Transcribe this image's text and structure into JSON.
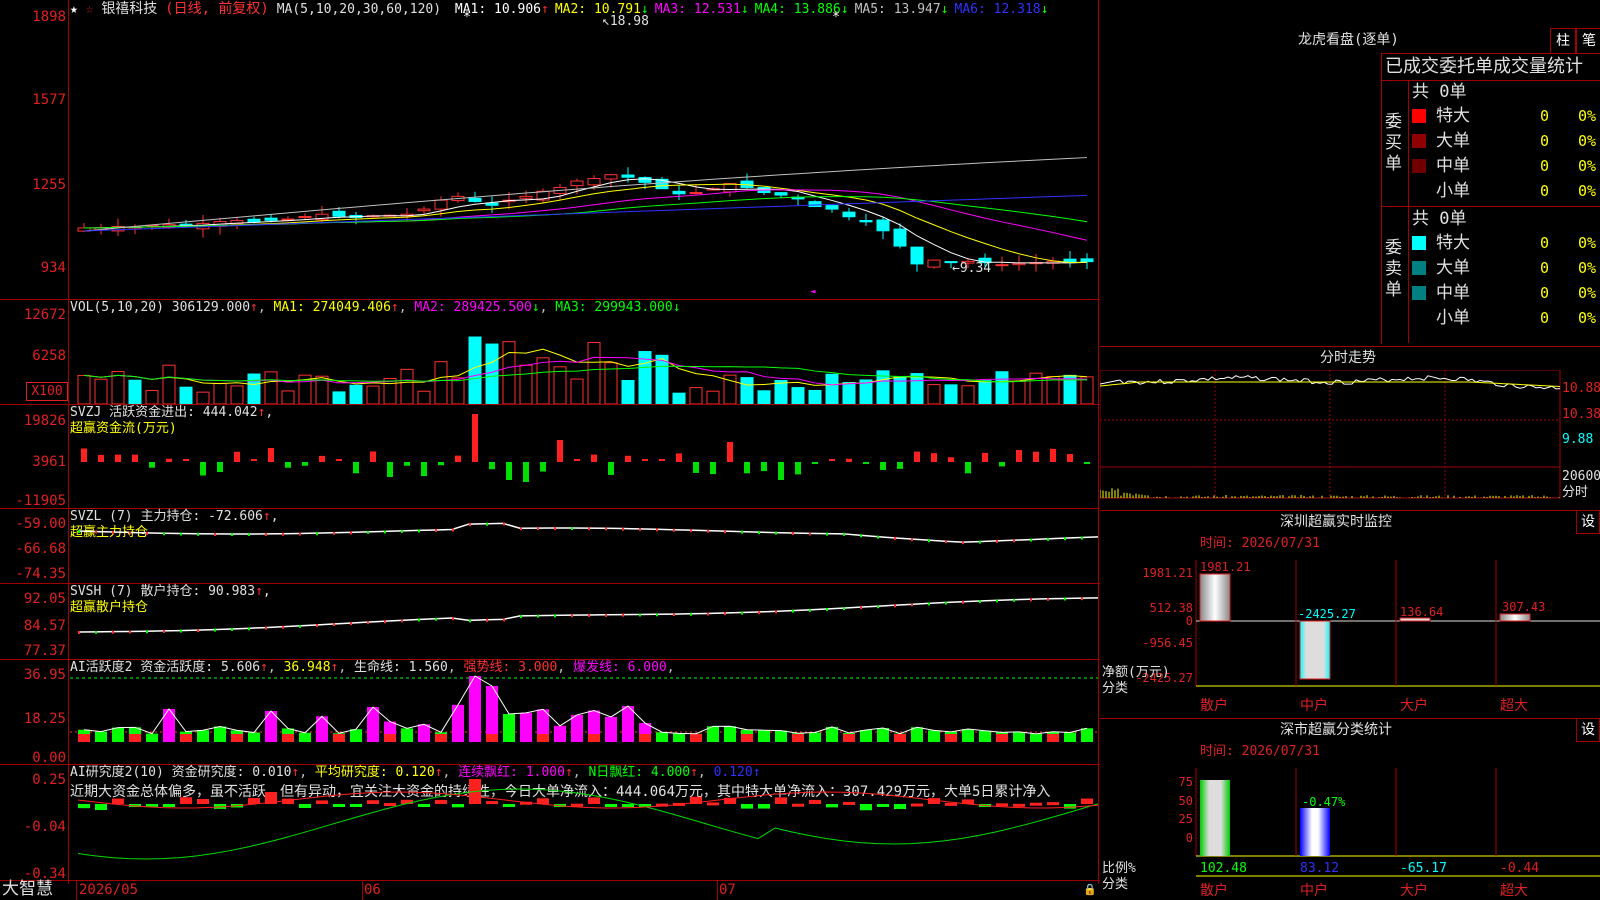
{
  "main_chart": {
    "star": "★",
    "logo_glyph": "☆",
    "stock_name": "银禧科技",
    "mode": "(日线, 前复权)",
    "ma_params": "MA(5,10,20,30,60,120)",
    "ma": [
      {
        "label": "MA1:",
        "value": "10.906",
        "arrow": "↑",
        "color": "#ffffff"
      },
      {
        "label": "MA2:",
        "value": "10.791",
        "arrow": "↓",
        "color": "#ffff00"
      },
      {
        "label": "MA3:",
        "value": "12.531",
        "arrow": "↓",
        "color": "#ff00ff"
      },
      {
        "label": "MA4:",
        "value": "13.886",
        "arrow": "↓",
        "color": "#00ff00"
      },
      {
        "label": "MA5:",
        "value": "13.947",
        "arrow": "↓",
        "color": "#c0c0c0"
      },
      {
        "label": "MA6:",
        "value": "12.318",
        "arrow": "↓",
        "color": "#3030ff"
      }
    ],
    "y_ticks": [
      "1898",
      "1577",
      "1255",
      "934"
    ],
    "high_label": "18.98",
    "low_label": "←9.34",
    "marker_star": "*"
  },
  "vol": {
    "title": "VOL(5,10,20)",
    "value": "306129.000",
    "value_arrow": "↑",
    "ma1": "MA1: 274049.406",
    "ma1_arrow": "↑",
    "ma2": "MA2: 289425.500",
    "ma2_arrow": "↓",
    "ma3": "MA3: 299943.000",
    "ma3_arrow": "↓",
    "y_ticks": [
      "12672",
      "6258"
    ],
    "unit": "X100"
  },
  "svzj": {
    "title": "SVZJ  活跃资金进出: 444.042",
    "arrow": "↑",
    "subtitle": "超赢资金流(万元)",
    "y_ticks": [
      "19826",
      "3961",
      "-11905"
    ]
  },
  "svzl": {
    "title": "SVZL (7) 主力持仓: -72.606",
    "arrow": "↑",
    "subtitle": "超赢主力持仓",
    "y_ticks": [
      "-59.00",
      "-66.68",
      "-74.35"
    ]
  },
  "svsh": {
    "title": "SVSH (7) 散户持仓: 90.983",
    "arrow": "↑",
    "subtitle": "超赢散户持仓",
    "y_ticks": [
      "92.05",
      "84.57",
      "77.37"
    ]
  },
  "ai_active": {
    "title": "AI活跃度2 资金活跃度: 5.606",
    "arrow1": "↑",
    "v2": "36.948",
    "life": "生命线: 1.560",
    "strong": "强势线: 3.000",
    "burst": "爆发线: 6.000",
    "y_ticks": [
      "36.95",
      "18.25",
      "0.00"
    ]
  },
  "ai_research": {
    "title": "AI研究度2(10) 资金研究度: 0.010",
    "arrow1": "↑",
    "avg": "平均研究度: 0.120",
    "cont": "连续飘红: 1.000",
    "nday": "N日飘红: 4.000",
    "last": "0.120",
    "comment": "近期大资金总体偏多，虽不活跃，但有异动，宜关注大资金的持续性，今日大单净流入：444.064万元，其中特大单净流入：307.429万元，大单5日累计净入",
    "y_ticks": [
      "0.25",
      "-0.04",
      "-0.34"
    ]
  },
  "bottom_bar": {
    "brand": "大智慧",
    "dates": [
      "2026/05",
      "06",
      "07"
    ]
  },
  "dragon": {
    "title": "龙虎看盘(逐单)",
    "btn1": "柱",
    "btn2": "笔",
    "stats_title": "已成交委托单成交量统计",
    "buy_label": "委买单",
    "sell_label": "委卖单",
    "buy_total": "共 0单",
    "sell_total": "共 0单",
    "buy_rows": [
      {
        "name": "特大",
        "count": "0",
        "pct": "0%",
        "color": "#ff0000"
      },
      {
        "name": "大单",
        "count": "0",
        "pct": "0%",
        "color": "#900000"
      },
      {
        "name": "中单",
        "count": "0",
        "pct": "0%",
        "color": "#700000"
      },
      {
        "name": "小单",
        "count": "0",
        "pct": "0%",
        "color": "#000000"
      }
    ],
    "sell_rows": [
      {
        "name": "特大",
        "count": "0",
        "pct": "0%",
        "color": "#00ffff"
      },
      {
        "name": "大单",
        "count": "0",
        "pct": "0%",
        "color": "#008080"
      },
      {
        "name": "中单",
        "count": "0",
        "pct": "0%",
        "color": "#008080"
      },
      {
        "name": "小单",
        "count": "0",
        "pct": "0%",
        "color": "#000000"
      }
    ]
  },
  "intraday": {
    "title": "分时走势",
    "prices": [
      "10.88",
      "10.38",
      "9.88"
    ],
    "vol": "20600",
    "vol_label": "分时"
  },
  "sz_monitor": {
    "title": "深圳超赢实时监控",
    "setting": "设",
    "time": "时间: 2026/07/31",
    "y_ticks": [
      "1981.21",
      "512.38",
      "0",
      "-956.45",
      "-2425.27"
    ],
    "ylabel": "净额(万元)",
    "xlabel": "分类",
    "categories": [
      "散户",
      "中户",
      "大户",
      "超大"
    ],
    "bar_labels": [
      "1981.21",
      "-2425.27",
      "136.64",
      "307.43"
    ]
  },
  "sz_class": {
    "title": "深市超赢分类统计",
    "setting": "设",
    "time": "时间: 2026/07/31",
    "y_ticks": [
      "75",
      "50",
      "25",
      "0"
    ],
    "ylabel": "比例%",
    "xlabel": "分类",
    "categories": [
      "散户",
      "中户",
      "大户",
      "超大"
    ],
    "top_label": "-0.47%",
    "values": [
      "102.48",
      "83.12",
      "-65.17",
      "-0.44"
    ]
  }
}
